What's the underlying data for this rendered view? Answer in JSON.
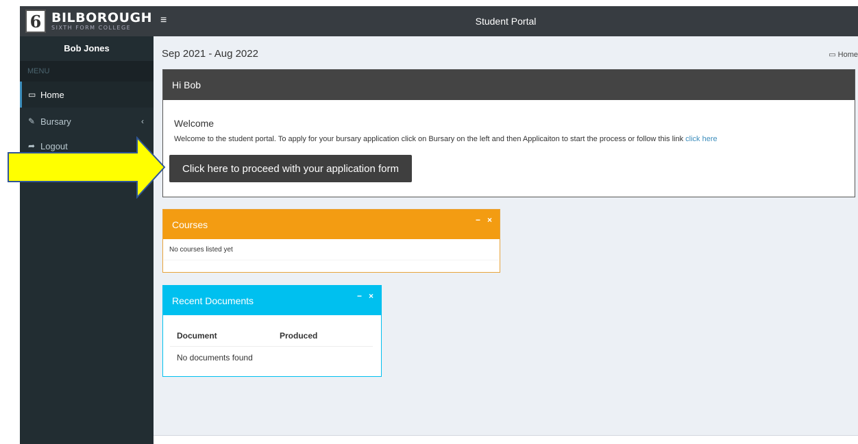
{
  "brand": {
    "badge": "6",
    "name": "BILBOROUGH",
    "subtitle": "SIXTH FORM COLLEGE"
  },
  "sidebar": {
    "user": "Bob Jones",
    "menu_header": "MENU",
    "items": [
      {
        "label": "Home",
        "icon": "laptop-icon",
        "glyph": "▭"
      },
      {
        "label": "Bursary",
        "icon": "edit-icon",
        "glyph": "✎",
        "chevron": "‹"
      },
      {
        "label": "Logout",
        "icon": "share-icon",
        "glyph": "➦"
      }
    ]
  },
  "topbar": {
    "menu_glyph": "≡",
    "title": "Student Portal"
  },
  "content": {
    "period": "Sep 2021 - Aug 2022",
    "breadcrumb_icon": "▭",
    "breadcrumb": "Home"
  },
  "welcome_box": {
    "title": "Hi Bob",
    "heading": "Welcome",
    "text": "Welcome to the student portal. To apply for your bursary application click on Bursary on the left and then Applicaiton to start the process or follow this link ",
    "link": "click here",
    "button": "Click here to proceed with your application form"
  },
  "courses_box": {
    "title": "Courses",
    "collapse_glyph": "−",
    "close_glyph": "×",
    "empty": "No courses listed yet"
  },
  "documents_box": {
    "title": "Recent Documents",
    "collapse_glyph": "−",
    "close_glyph": "×",
    "columns": [
      "Document",
      "Produced"
    ],
    "empty": "No documents found"
  },
  "colors": {
    "sidebar": "#222d32",
    "header": "#373c41",
    "orange": "#f39c12",
    "aqua": "#00c0ef",
    "arrow_fill": "#ffff00",
    "arrow_stroke": "#2f5597"
  }
}
